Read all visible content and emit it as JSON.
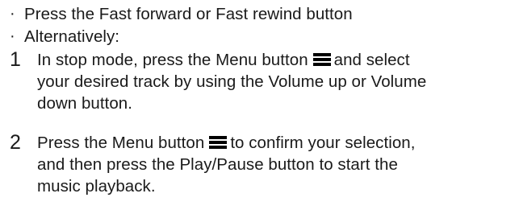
{
  "bullets": [
    {
      "mark": "·",
      "text": "Press the Fast forward or Fast rewind button"
    },
    {
      "mark": "·",
      "text": "Alternatively:"
    }
  ],
  "steps": [
    {
      "number": "1",
      "line1_before_icon": "In stop mode, press the Menu button",
      "line1_after_icon": "and select",
      "line2": "your desired track by using the Volume up or Volume",
      "line3": "down button.",
      "icon": "menu-icon"
    },
    {
      "number": "2",
      "line1_before_icon": "Press the Menu button",
      "line1_after_icon": "to confirm your selection,",
      "line2": "and then press the Play/Pause button to start the",
      "line3": "music playback.",
      "icon": "menu-icon"
    }
  ]
}
